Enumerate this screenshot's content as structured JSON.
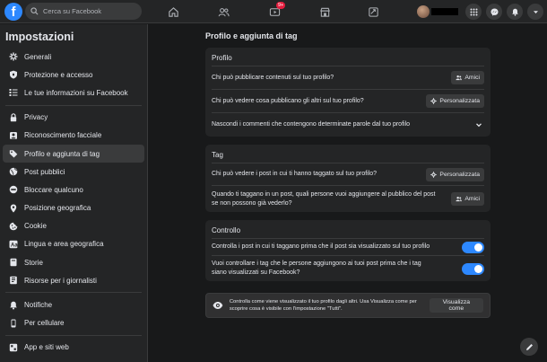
{
  "topbar": {
    "logo": "f",
    "search_placeholder": "Cerca su Facebook",
    "notification_badge": "9+",
    "icons": [
      "home-icon",
      "friends-icon",
      "watch-icon",
      "marketplace-icon",
      "groups-icon",
      "menu-grid-icon",
      "messenger-icon",
      "bell-icon",
      "caret-down-icon"
    ],
    "accent": "#2d88ff",
    "badge_color": "#e41e3f"
  },
  "sidebar": {
    "title": "Impostazioni",
    "items": [
      {
        "label": "Generali",
        "icon": "gear-icon"
      },
      {
        "label": "Protezione e accesso",
        "icon": "shield-icon"
      },
      {
        "label": "Le tue informazioni su Facebook",
        "icon": "list-icon"
      },
      {
        "label": "Privacy",
        "icon": "lock-icon"
      },
      {
        "label": "Riconoscimento facciale",
        "icon": "face-icon"
      },
      {
        "label": "Profilo e aggiunta di tag",
        "icon": "tag-icon",
        "active": true
      },
      {
        "label": "Post pubblici",
        "icon": "globe-icon"
      },
      {
        "label": "Bloccare qualcuno",
        "icon": "block-icon"
      },
      {
        "label": "Posizione geografica",
        "icon": "location-icon"
      },
      {
        "label": "Cookie",
        "icon": "cookie-icon"
      },
      {
        "label": "Lingua e area geografica",
        "icon": "language-icon"
      },
      {
        "label": "Storie",
        "icon": "book-icon"
      },
      {
        "label": "Risorse per i giornalisti",
        "icon": "journalist-icon"
      },
      {
        "label": "Notifiche",
        "icon": "bell-icon"
      },
      {
        "label": "Per cellulare",
        "icon": "phone-icon"
      },
      {
        "label": "App e siti web",
        "icon": "apps-icon"
      }
    ]
  },
  "main": {
    "title": "Profilo e aggiunta di tag",
    "profilo": {
      "title": "Profilo",
      "rows": [
        {
          "text": "Chi può pubblicare contenuti sul tuo profilo?",
          "button": "Amici"
        },
        {
          "text": "Chi può vedere cosa pubblicano gli altri sul tuo profilo?",
          "button": "Personalizzata"
        },
        {
          "text": "Nascondi i commenti che contengono determinate parole dal tuo profilo"
        }
      ]
    },
    "tag": {
      "title": "Tag",
      "rows": [
        {
          "text": "Chi può vedere i post in cui ti hanno taggato sul tuo profilo?",
          "button": "Personalizzata"
        },
        {
          "text": "Quando ti taggano in un post, quali persone vuoi aggiungere al pubblico del post se non possono già vederlo?",
          "button": "Amici"
        }
      ]
    },
    "controllo": {
      "title": "Controllo",
      "rows": [
        {
          "text": "Controlla i post in cui ti taggano prima che il post sia visualizzato sul tuo profilo",
          "toggle": "on"
        },
        {
          "text": "Vuoi controllare i tag che le persone aggiungono ai tuoi post prima che i tag siano visualizzati su Facebook?",
          "toggle": "on"
        }
      ]
    },
    "notice": {
      "text": "Controlla come viene visualizzato il tuo profilo dagli altri. Usa Visualizza come per scoprire cosa è visibile con l'impostazione \"Tutti\".",
      "button": "Visualizza come"
    }
  }
}
